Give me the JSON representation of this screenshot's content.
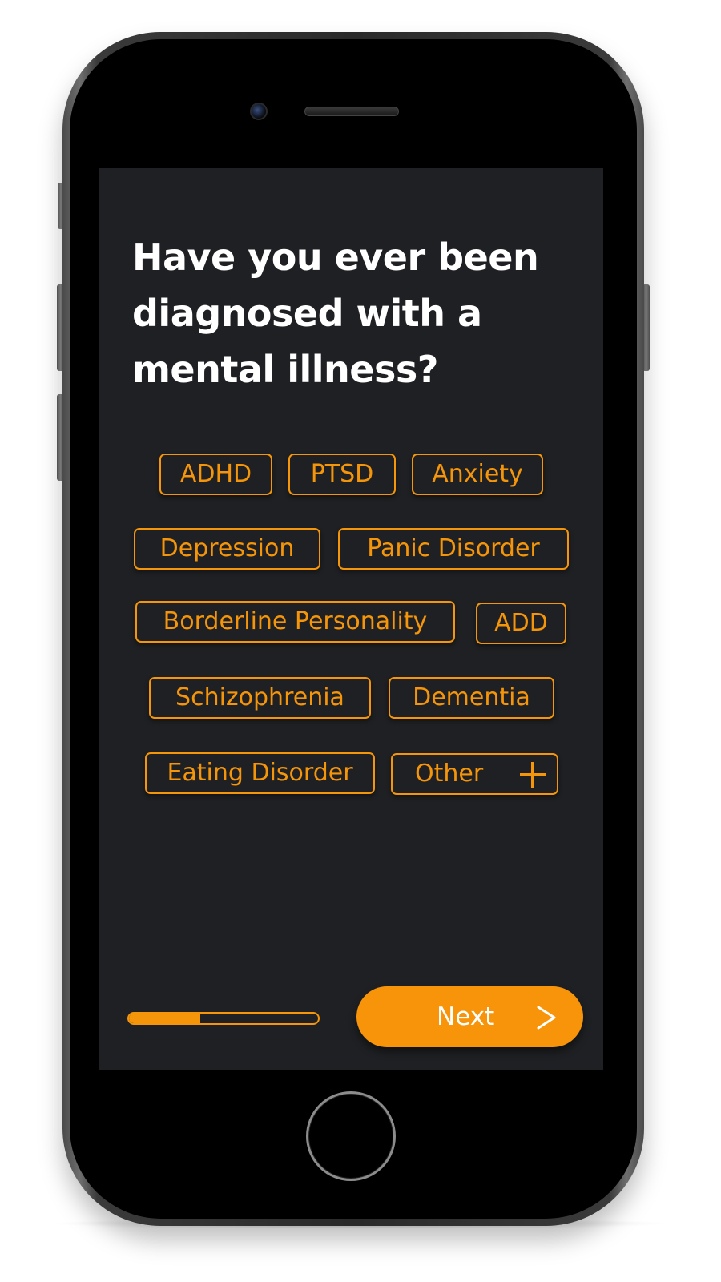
{
  "question": {
    "line1": "Have you ever been",
    "line2": "diagnosed with a",
    "line3": "mental illness?"
  },
  "options": [
    {
      "label": "ADHD"
    },
    {
      "label": "PTSD"
    },
    {
      "label": "Anxiety"
    },
    {
      "label": "Depression"
    },
    {
      "label": "Panic Disorder"
    },
    {
      "label": "Borderline Personality"
    },
    {
      "label": "ADD"
    },
    {
      "label": "Schizophrenia"
    },
    {
      "label": "Dementia"
    },
    {
      "label": "Eating Disorder"
    },
    {
      "label": "Other",
      "icon": "plus-icon"
    }
  ],
  "progress": {
    "fraction": 0.375
  },
  "next_button": {
    "label": "Next",
    "icon": "chevron-right-icon"
  },
  "colors": {
    "accent": "#f5950a",
    "screen_background": "#1f2023",
    "text_primary": "#ffffff"
  }
}
